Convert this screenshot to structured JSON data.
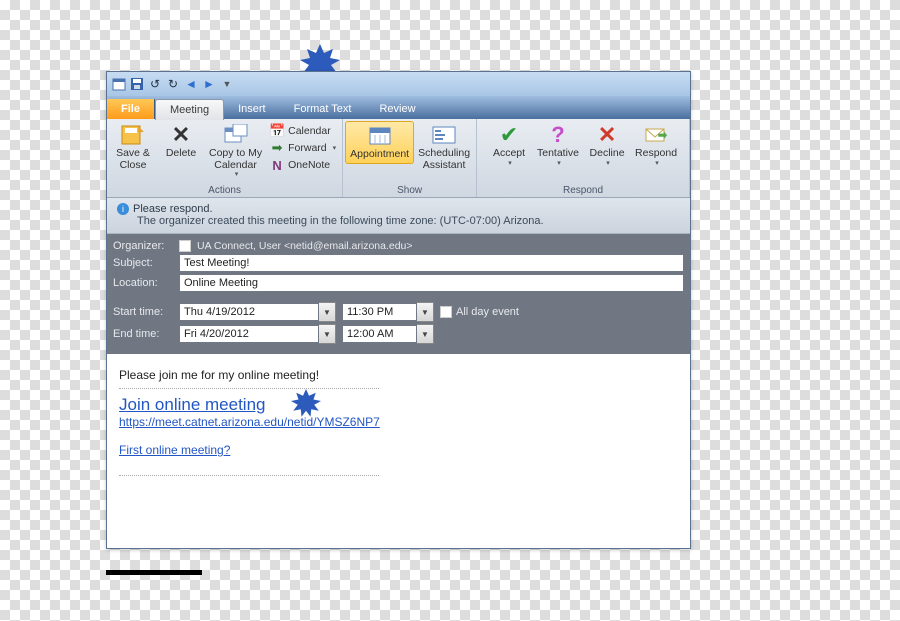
{
  "tabs": {
    "file": "File",
    "meeting": "Meeting",
    "insert": "Insert",
    "format_text": "Format Text",
    "review": "Review"
  },
  "ribbon": {
    "actions": {
      "save_close": "Save &\nClose",
      "delete": "Delete",
      "copy_cal": "Copy to My\nCalendar",
      "calendar": "Calendar",
      "forward": "Forward",
      "onenote": "OneNote",
      "group_label": "Actions"
    },
    "show": {
      "appointment": "Appointment",
      "scheduling": "Scheduling\nAssistant",
      "group_label": "Show"
    },
    "respond": {
      "accept": "Accept",
      "tentative": "Tentative",
      "decline": "Decline",
      "respond": "Respond",
      "group_label": "Respond"
    }
  },
  "info": {
    "respond": "Please respond.",
    "timezone_msg": "The organizer created this meeting in the following time zone: (UTC-07:00) Arizona."
  },
  "fields": {
    "organizer_label": "Organizer:",
    "organizer_value": "UA Connect, User <netid@email.arizona.edu>",
    "subject_label": "Subject:",
    "subject_value": "Test Meeting!",
    "location_label": "Location:",
    "location_value": "Online Meeting",
    "start_label": "Start time:",
    "start_date": "Thu 4/19/2012",
    "start_time": "11:30 PM",
    "end_label": "End time:",
    "end_date": "Fri 4/20/2012",
    "end_time": "12:00 AM",
    "allday_label": "All day event"
  },
  "body": {
    "intro": "Please join me for my online meeting!",
    "join_link": "Join online meeting",
    "url": "https://meet.catnet.arizona.edu/netid/YMSZ6NP7",
    "first_link": "First online meeting?"
  }
}
